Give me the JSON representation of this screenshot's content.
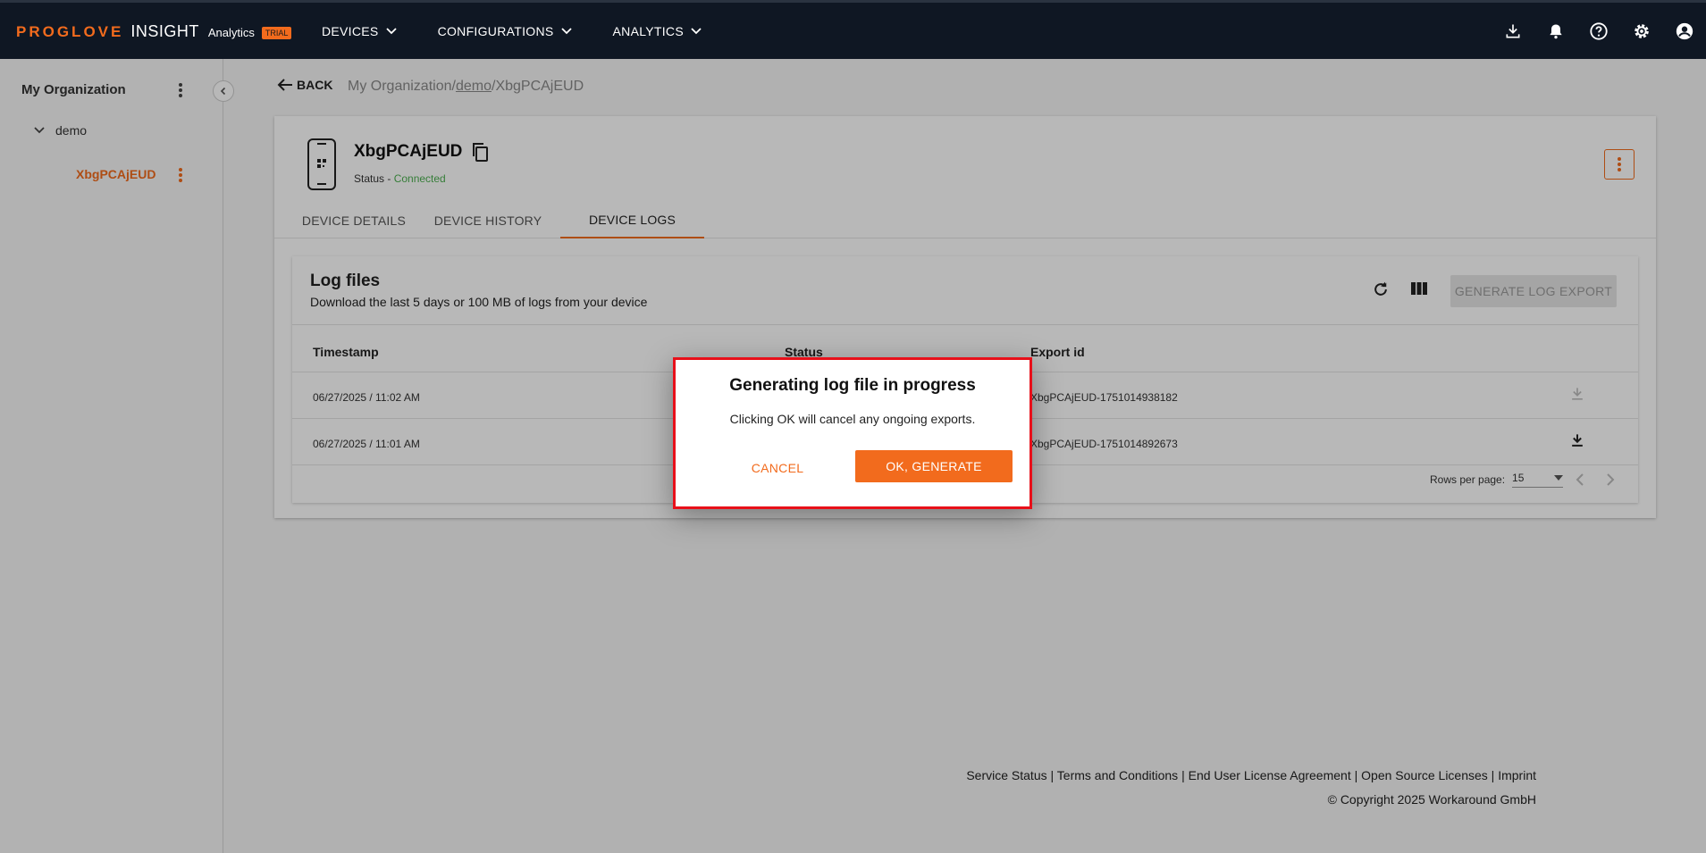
{
  "header": {
    "brand_primary": "PROGLOVE",
    "brand_secondary": "INSIGHT",
    "product": "Analytics",
    "badge": "TRIAL",
    "nav": [
      {
        "label": "DEVICES"
      },
      {
        "label": "CONFIGURATIONS"
      },
      {
        "label": "ANALYTICS"
      }
    ],
    "icons": [
      "download-icon",
      "bell-icon",
      "help-icon",
      "gear-icon",
      "account-icon"
    ]
  },
  "sidebar": {
    "org": "My Organization",
    "group": "demo",
    "device": "XbgPCAjEUD"
  },
  "main": {
    "back_label": "BACK",
    "breadcrumb": {
      "root": "My Organization",
      "sep": "/",
      "group": "demo",
      "device": "XbgPCAjEUD"
    },
    "device": {
      "name": "XbgPCAjEUD",
      "status_label": "Status - ",
      "status_value": "Connected"
    },
    "tabs": [
      {
        "label": "DEVICE DETAILS"
      },
      {
        "label": "DEVICE HISTORY"
      },
      {
        "label": "DEVICE LOGS"
      }
    ],
    "logs": {
      "title": "Log files",
      "subtitle": "Download the last 5 days or 100 MB of logs from your device",
      "generate_label": "GENERATE LOG EXPORT",
      "columns": {
        "timestamp": "Timestamp",
        "status": "Status",
        "export_id": "Export id"
      },
      "rows": [
        {
          "timestamp": "06/27/2025 / 11:02 AM",
          "export_id": "XbgPCAjEUD-1751014938182"
        },
        {
          "timestamp": "06/27/2025 / 11:01 AM",
          "export_id": "XbgPCAjEUD-1751014892673"
        }
      ],
      "pager": {
        "label": "Rows per page:",
        "value": "15"
      }
    }
  },
  "footer": {
    "links": [
      "Service Status",
      "Terms and Conditions",
      "End User License Agreement",
      "Open Source Licenses",
      "Imprint"
    ],
    "separator": " | ",
    "copyright": "© Copyright 2025 Workaround GmbH"
  },
  "dialog": {
    "title": "Generating log file in progress",
    "message": "Clicking OK will cancel any ongoing exports.",
    "cancel_label": "CANCEL",
    "ok_label": "OK, GENERATE"
  },
  "colors": {
    "accent": "#f26b1d",
    "topbar": "#0f1723",
    "connected": "#4caf50",
    "dialog_border": "#e8101a"
  }
}
